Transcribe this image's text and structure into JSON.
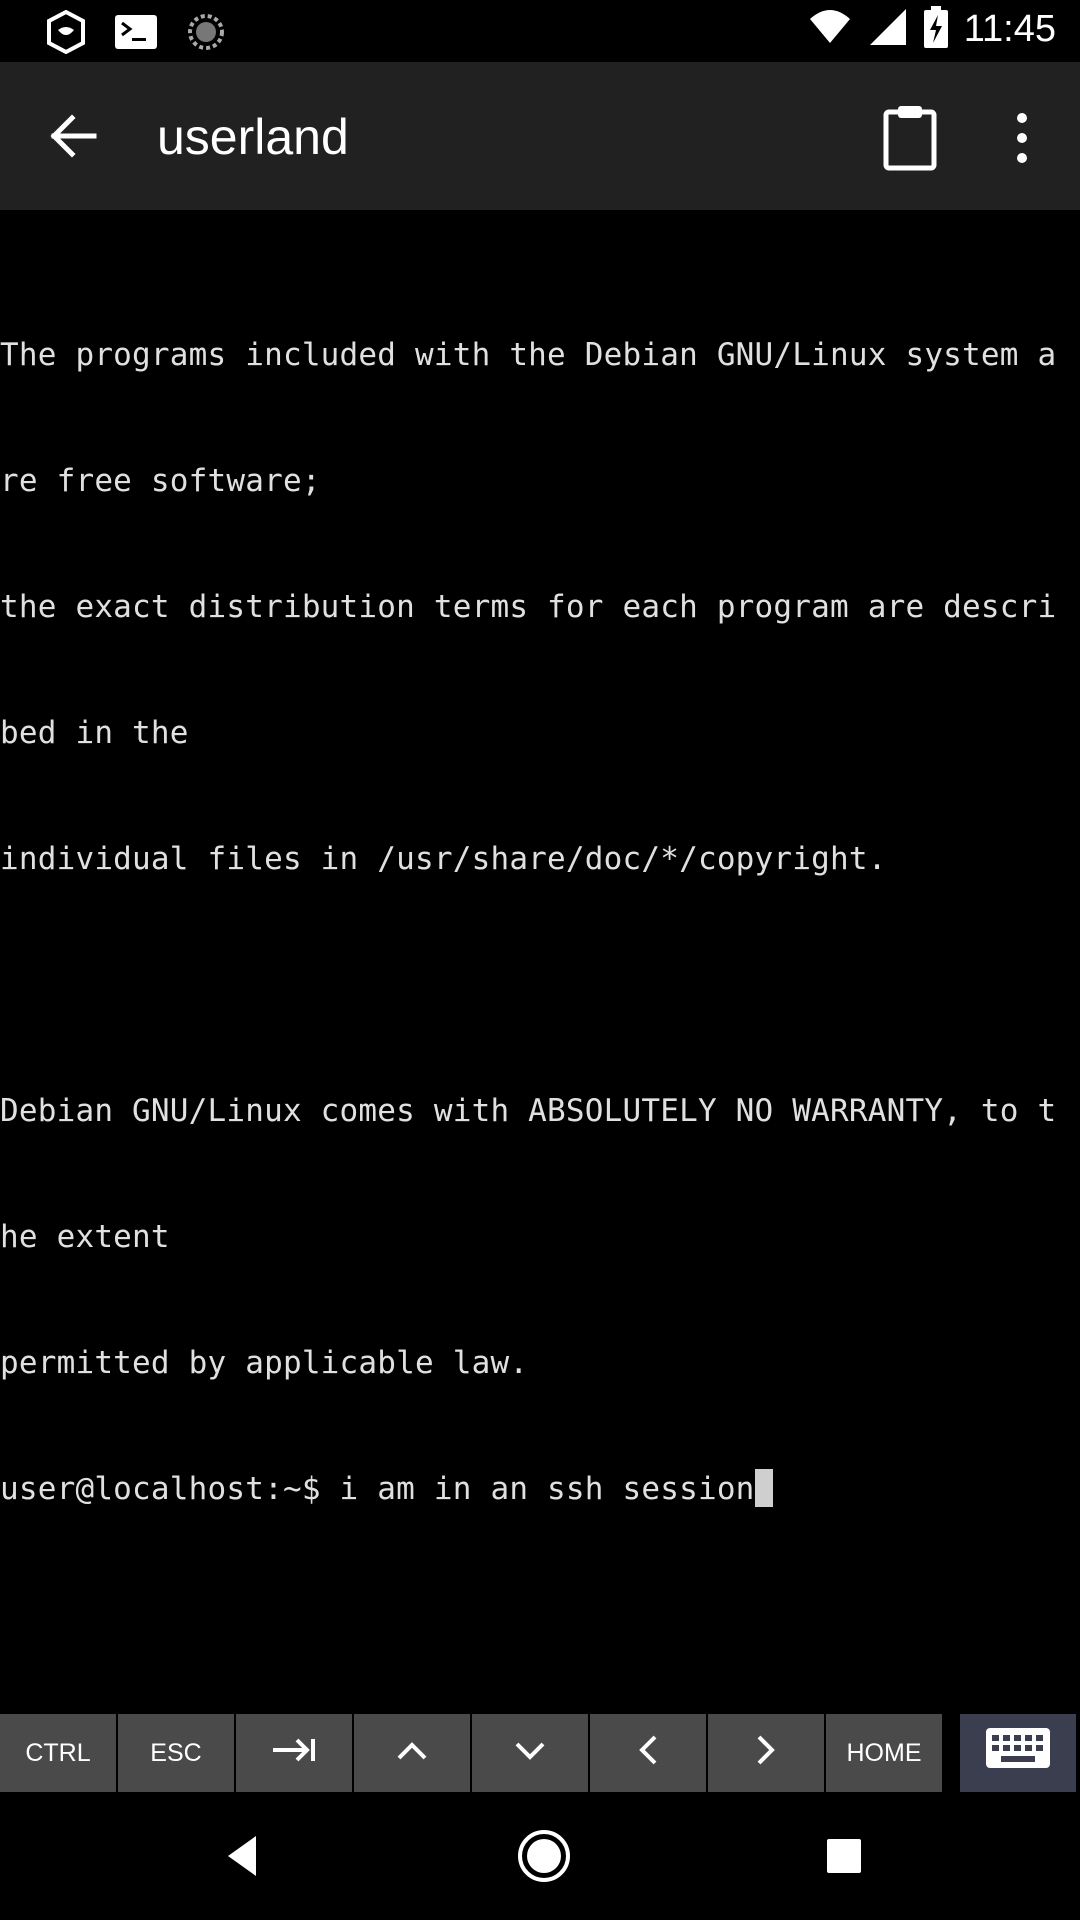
{
  "status_bar": {
    "time": "11:45",
    "left_icons": [
      "shield-icon",
      "terminal-icon",
      "loading-icon"
    ],
    "right_icons": [
      "wifi-icon",
      "signal-icon",
      "battery-charging-icon"
    ]
  },
  "app_bar": {
    "title": "userland",
    "icons": [
      "back-arrow-icon",
      "clipboard-icon",
      "more-vert-icon"
    ]
  },
  "terminal": {
    "lines": [
      "The programs included with the Debian GNU/Linux system a",
      "re free software;",
      "the exact distribution terms for each program are descri",
      "bed in the",
      "individual files in /usr/share/doc/*/copyright.",
      "",
      "Debian GNU/Linux comes with ABSOLUTELY NO WARRANTY, to t",
      "he extent",
      "permitted by applicable law."
    ],
    "prompt": "user@localhost:~$ ",
    "input": "i am in an ssh session"
  },
  "extra_keys": {
    "ctrl": "CTRL",
    "esc": "ESC",
    "home": "HOME",
    "icons": [
      "tab-icon",
      "arrow-up-icon",
      "arrow-down-icon",
      "arrow-left-icon",
      "arrow-right-icon",
      "keyboard-icon"
    ]
  },
  "nav_bar": {
    "icons": [
      "nav-back-icon",
      "nav-home-icon",
      "nav-recents-icon"
    ]
  },
  "colors": {
    "app_bar_bg": "#212121",
    "terminal_bg": "#000000",
    "terminal_text": "#e0e0e0",
    "key_bg": "#4a4a4a",
    "keyboard_key_bg": "#3a3e4e"
  }
}
